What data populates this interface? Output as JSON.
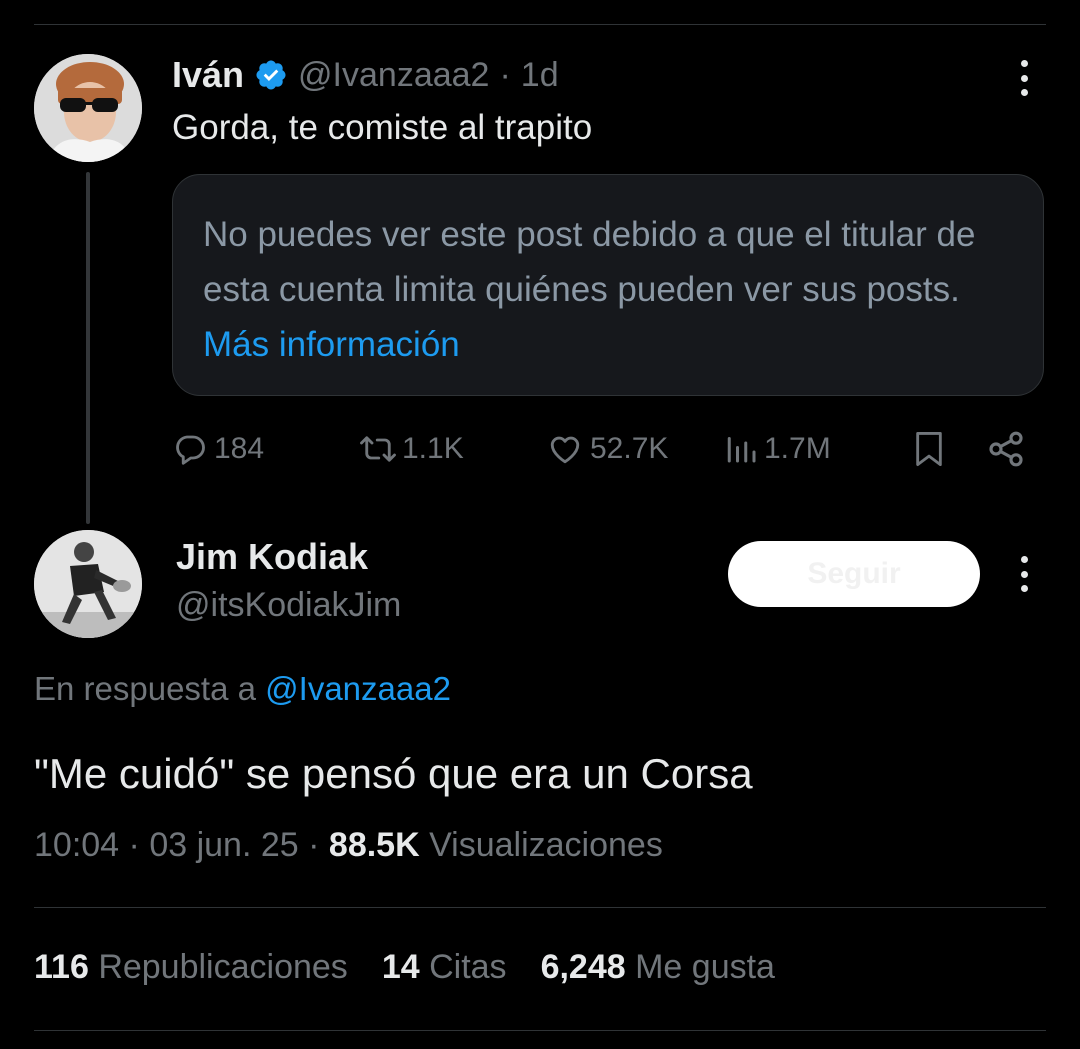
{
  "parent_post": {
    "author_name": "Iván",
    "verified_icon": "verified-badge-icon",
    "handle": "@Ivanzaaa2",
    "separator": "·",
    "time": "1d",
    "text": "Gorda, te comiste al trapito",
    "quoted_notice": {
      "text": "No puedes ver este post debido a que el titular de esta cuenta limita quiénes pueden ver sus posts.",
      "link": "Más información"
    },
    "actions": {
      "replies": "184",
      "reposts": "1.1K",
      "likes": "52.7K",
      "views": "1.7M"
    }
  },
  "reply_post": {
    "author_name": "Jim Kodiak",
    "handle": "@itsKodiakJim",
    "follow_label": "Seguir",
    "reply_to_label": "En respuesta a",
    "reply_to_handle": "@Ivanzaaa2",
    "text": "\"Me cuidó\" se pensó que era un Corsa",
    "time": "10:04",
    "separator": "·",
    "date": "03 jun. 25",
    "views_count": "88.5K",
    "views_label": "Visualizaciones",
    "stats": [
      {
        "count": "116",
        "label": "Republicaciones"
      },
      {
        "count": "14",
        "label": "Citas"
      },
      {
        "count": "6,248",
        "label": "Me gusta"
      }
    ]
  },
  "colors": {
    "background": "#000000",
    "primary_text": "#e7e9ea",
    "secondary_text": "#71767b",
    "accent": "#1d9bf0",
    "card_background": "#16181c",
    "divider": "#2f3336"
  }
}
